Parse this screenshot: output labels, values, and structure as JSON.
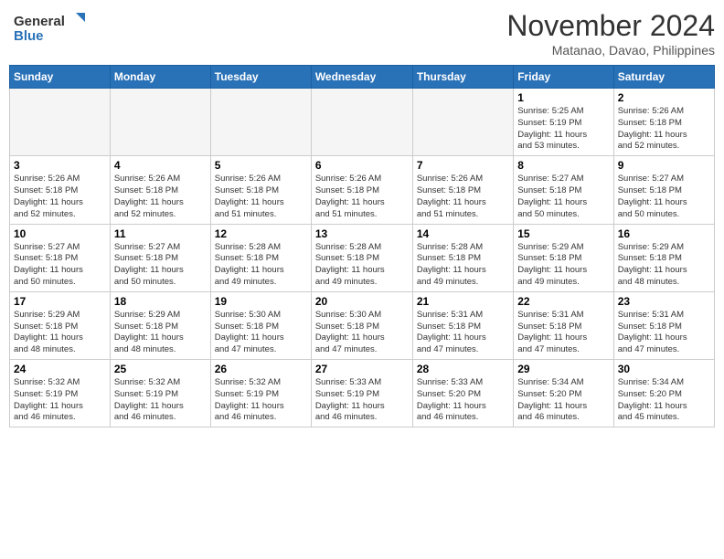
{
  "logo": {
    "line1": "General",
    "line2": "Blue"
  },
  "title": "November 2024",
  "subtitle": "Matanao, Davao, Philippines",
  "days_of_week": [
    "Sunday",
    "Monday",
    "Tuesday",
    "Wednesday",
    "Thursday",
    "Friday",
    "Saturday"
  ],
  "weeks": [
    [
      {
        "num": "",
        "info": ""
      },
      {
        "num": "",
        "info": ""
      },
      {
        "num": "",
        "info": ""
      },
      {
        "num": "",
        "info": ""
      },
      {
        "num": "",
        "info": ""
      },
      {
        "num": "1",
        "info": "Sunrise: 5:25 AM\nSunset: 5:19 PM\nDaylight: 11 hours\nand 53 minutes."
      },
      {
        "num": "2",
        "info": "Sunrise: 5:26 AM\nSunset: 5:18 PM\nDaylight: 11 hours\nand 52 minutes."
      }
    ],
    [
      {
        "num": "3",
        "info": "Sunrise: 5:26 AM\nSunset: 5:18 PM\nDaylight: 11 hours\nand 52 minutes."
      },
      {
        "num": "4",
        "info": "Sunrise: 5:26 AM\nSunset: 5:18 PM\nDaylight: 11 hours\nand 52 minutes."
      },
      {
        "num": "5",
        "info": "Sunrise: 5:26 AM\nSunset: 5:18 PM\nDaylight: 11 hours\nand 51 minutes."
      },
      {
        "num": "6",
        "info": "Sunrise: 5:26 AM\nSunset: 5:18 PM\nDaylight: 11 hours\nand 51 minutes."
      },
      {
        "num": "7",
        "info": "Sunrise: 5:26 AM\nSunset: 5:18 PM\nDaylight: 11 hours\nand 51 minutes."
      },
      {
        "num": "8",
        "info": "Sunrise: 5:27 AM\nSunset: 5:18 PM\nDaylight: 11 hours\nand 50 minutes."
      },
      {
        "num": "9",
        "info": "Sunrise: 5:27 AM\nSunset: 5:18 PM\nDaylight: 11 hours\nand 50 minutes."
      }
    ],
    [
      {
        "num": "10",
        "info": "Sunrise: 5:27 AM\nSunset: 5:18 PM\nDaylight: 11 hours\nand 50 minutes."
      },
      {
        "num": "11",
        "info": "Sunrise: 5:27 AM\nSunset: 5:18 PM\nDaylight: 11 hours\nand 50 minutes."
      },
      {
        "num": "12",
        "info": "Sunrise: 5:28 AM\nSunset: 5:18 PM\nDaylight: 11 hours\nand 49 minutes."
      },
      {
        "num": "13",
        "info": "Sunrise: 5:28 AM\nSunset: 5:18 PM\nDaylight: 11 hours\nand 49 minutes."
      },
      {
        "num": "14",
        "info": "Sunrise: 5:28 AM\nSunset: 5:18 PM\nDaylight: 11 hours\nand 49 minutes."
      },
      {
        "num": "15",
        "info": "Sunrise: 5:29 AM\nSunset: 5:18 PM\nDaylight: 11 hours\nand 49 minutes."
      },
      {
        "num": "16",
        "info": "Sunrise: 5:29 AM\nSunset: 5:18 PM\nDaylight: 11 hours\nand 48 minutes."
      }
    ],
    [
      {
        "num": "17",
        "info": "Sunrise: 5:29 AM\nSunset: 5:18 PM\nDaylight: 11 hours\nand 48 minutes."
      },
      {
        "num": "18",
        "info": "Sunrise: 5:29 AM\nSunset: 5:18 PM\nDaylight: 11 hours\nand 48 minutes."
      },
      {
        "num": "19",
        "info": "Sunrise: 5:30 AM\nSunset: 5:18 PM\nDaylight: 11 hours\nand 47 minutes."
      },
      {
        "num": "20",
        "info": "Sunrise: 5:30 AM\nSunset: 5:18 PM\nDaylight: 11 hours\nand 47 minutes."
      },
      {
        "num": "21",
        "info": "Sunrise: 5:31 AM\nSunset: 5:18 PM\nDaylight: 11 hours\nand 47 minutes."
      },
      {
        "num": "22",
        "info": "Sunrise: 5:31 AM\nSunset: 5:18 PM\nDaylight: 11 hours\nand 47 minutes."
      },
      {
        "num": "23",
        "info": "Sunrise: 5:31 AM\nSunset: 5:18 PM\nDaylight: 11 hours\nand 47 minutes."
      }
    ],
    [
      {
        "num": "24",
        "info": "Sunrise: 5:32 AM\nSunset: 5:19 PM\nDaylight: 11 hours\nand 46 minutes."
      },
      {
        "num": "25",
        "info": "Sunrise: 5:32 AM\nSunset: 5:19 PM\nDaylight: 11 hours\nand 46 minutes."
      },
      {
        "num": "26",
        "info": "Sunrise: 5:32 AM\nSunset: 5:19 PM\nDaylight: 11 hours\nand 46 minutes."
      },
      {
        "num": "27",
        "info": "Sunrise: 5:33 AM\nSunset: 5:19 PM\nDaylight: 11 hours\nand 46 minutes."
      },
      {
        "num": "28",
        "info": "Sunrise: 5:33 AM\nSunset: 5:20 PM\nDaylight: 11 hours\nand 46 minutes."
      },
      {
        "num": "29",
        "info": "Sunrise: 5:34 AM\nSunset: 5:20 PM\nDaylight: 11 hours\nand 46 minutes."
      },
      {
        "num": "30",
        "info": "Sunrise: 5:34 AM\nSunset: 5:20 PM\nDaylight: 11 hours\nand 45 minutes."
      }
    ]
  ]
}
